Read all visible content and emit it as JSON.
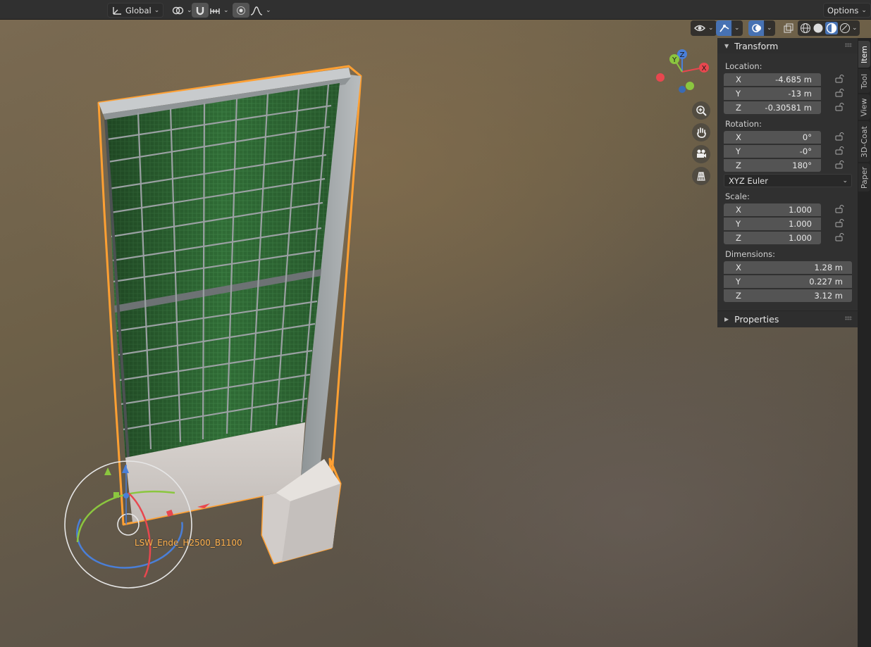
{
  "header": {
    "orientation_label": "Global",
    "options_label": "Options"
  },
  "viewport": {
    "object_name": "LSW_Ende_H2500_B1100",
    "gizmo_axes": {
      "x": "X",
      "y": "Y",
      "z": "Z"
    }
  },
  "sidebar": {
    "tabs": [
      "Item",
      "Tool",
      "View",
      "3D-Coat",
      "Paper"
    ],
    "active_tab": "Item",
    "transform": {
      "title": "Transform",
      "location_label": "Location:",
      "location": [
        {
          "axis": "X",
          "value": "-4.685 m"
        },
        {
          "axis": "Y",
          "value": "-13 m"
        },
        {
          "axis": "Z",
          "value": "-0.30581 m"
        }
      ],
      "rotation_label": "Rotation:",
      "rotation": [
        {
          "axis": "X",
          "value": "0°"
        },
        {
          "axis": "Y",
          "value": "-0°"
        },
        {
          "axis": "Z",
          "value": "180°"
        }
      ],
      "rotation_mode": "XYZ Euler",
      "scale_label": "Scale:",
      "scale": [
        {
          "axis": "X",
          "value": "1.000"
        },
        {
          "axis": "Y",
          "value": "1.000"
        },
        {
          "axis": "Z",
          "value": "1.000"
        }
      ],
      "dimensions_label": "Dimensions:",
      "dimensions": [
        {
          "axis": "X",
          "value": "1.28 m"
        },
        {
          "axis": "Y",
          "value": "0.227 m"
        },
        {
          "axis": "Z",
          "value": "3.12 m"
        }
      ]
    },
    "properties_title": "Properties"
  },
  "colors": {
    "accent": "#4772b3",
    "selection_outline": "#ffa033",
    "axis_x": "#e8474f",
    "axis_y": "#8bc63f",
    "axis_z": "#4a7fd8"
  }
}
